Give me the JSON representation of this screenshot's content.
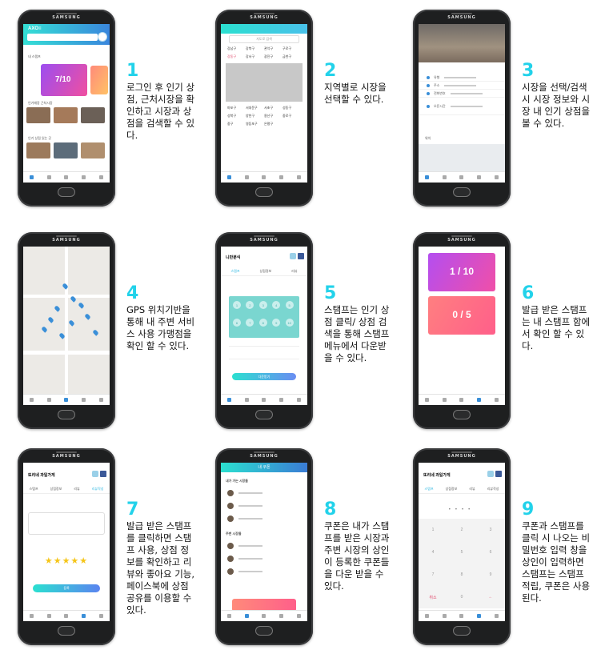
{
  "phone_brand": "SAMSUNG",
  "app_logo": "AXO≡",
  "steps": [
    {
      "num": "1",
      "text": "로그인 후 인기 상점, 근처시장을 확인하고 시장과 상점을 검색할 수 있다."
    },
    {
      "num": "2",
      "text": "지역별로 시장을 선택할 수 있다."
    },
    {
      "num": "3",
      "text": "시장을 선택/검색 시 시장 정보와 시장 내 인기 상점을 볼 수 있다."
    },
    {
      "num": "4",
      "text": "GPS 위치기반을 통해 내 주변 서비스 사용 가맹점을 확인 할 수 있다."
    },
    {
      "num": "5",
      "text": "스탬프는 인기 상점 클릭/ 상점 검색을 통해 스탬프 메뉴에서 다운받을 수 있다."
    },
    {
      "num": "6",
      "text": "발급 받은 스탬프는 내 스탬프 함에서 확인 할 수 있다."
    },
    {
      "num": "7",
      "text": "발급 받은 스탬프를 클릭하면 스탬프 사용, 상점 정보를 확인하고 리뷰와 좋아요 기능, 페이스북에 상점 공유를 이용할 수 있다."
    },
    {
      "num": "8",
      "text": "쿠폰은 내가 스탬프를 받은 시장과 주변 시장의 상인이 등록한 쿠폰들을 다운 받을 수 있다."
    },
    {
      "num": "9",
      "text": "쿠폰과 스탬프를 클릭 시 나오는 비밀번호 입력 창을 상인이 입력하면 스탬프는 스탬프 적립, 쿠폰은 사용 된다."
    }
  ],
  "screen1": {
    "section_stamp": "내 스탬프",
    "ratio": "7/10",
    "section_near": "인기매장 근처시장",
    "section_popular": "인기 상점 있는 곳"
  },
  "screen2": {
    "search_placeholder": "지도로 검색",
    "districts": [
      "강남구",
      "강북구",
      "관악구",
      "구로구",
      "강동구",
      "강서구",
      "광진구",
      "금천구",
      "마포구",
      "서대문구",
      "서초구",
      "성동구",
      "성북구",
      "양천구",
      "용산구",
      "중로구",
      "중구",
      "영등포구",
      "은평구"
    ]
  },
  "screen3": {
    "rows": [
      "유형",
      "주소",
      "전화번호",
      "오픈시간"
    ],
    "map_label": "위치"
  },
  "screen5": {
    "shop_name": "니만분식",
    "tabs": [
      "스탬프",
      "상점정보",
      "리뷰"
    ],
    "stamps": [
      "1",
      "2",
      "3",
      "4",
      "5",
      "6",
      "7",
      "8",
      "9",
      "10"
    ],
    "button": "다운받기"
  },
  "screen6": {
    "card1_ratio": "1 / 10",
    "card2_ratio": "0 / 5"
  },
  "screen7": {
    "shop_name": "또리네 과일가게",
    "tabs": [
      "스탬프",
      "상점정보",
      "리뷰",
      "리뷰작성"
    ],
    "button": "등록",
    "stars": "★★★★★"
  },
  "screen8": {
    "title": "내 쿠폰",
    "section1": "내가 가는 시장들",
    "section2": "주변 시장들"
  },
  "screen9": {
    "shop_name": "또리네 과일가게",
    "tabs": [
      "스탬프",
      "상점정보",
      "리뷰",
      "리뷰작성"
    ],
    "keys": [
      "1",
      "2",
      "3",
      "4",
      "5",
      "6",
      "7",
      "8",
      "9",
      "취소",
      "0",
      "←"
    ]
  }
}
